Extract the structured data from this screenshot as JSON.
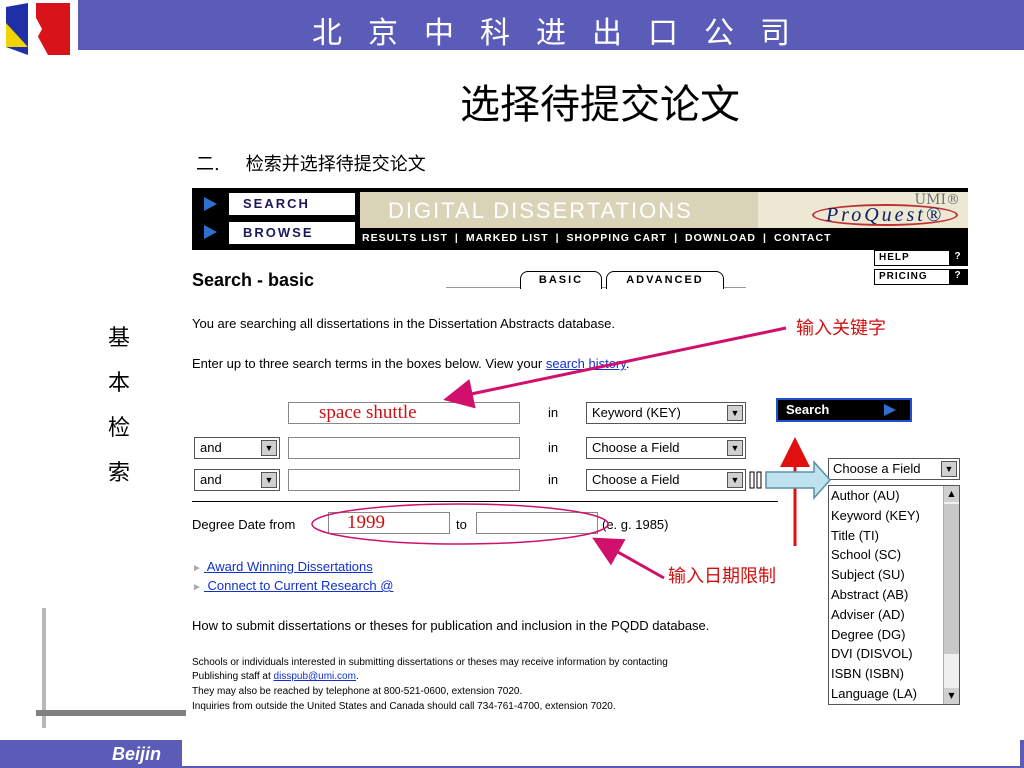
{
  "banner": {
    "title": "北京中科进出口公司"
  },
  "slide": {
    "title": "选择待提交论文",
    "subtitle_num": "二.",
    "subtitle_text": "检索并选择待提交论文"
  },
  "side_label": [
    "基",
    "本",
    "检",
    "索"
  ],
  "proquest": {
    "nav_search": "SEARCH",
    "nav_browse": "BROWSE",
    "banner_title": "DIGITAL DISSERTATIONS",
    "umi": "UMI®",
    "logo": "ProQuest®",
    "topnav": [
      "RESULTS LIST",
      "MARKED LIST",
      "SHOPPING CART",
      "DOWNLOAD",
      "CONTACT"
    ],
    "help": "HELP",
    "pricing": "PRICING",
    "q": "?",
    "page_heading": "Search - basic",
    "tab_basic": "BASIC",
    "tab_advanced": "ADVANCED",
    "info_line1": "You are searching all dissertations in the Dissertation Abstracts database.",
    "info_line2_prefix": "Enter up to three search terms in the boxes below. View your ",
    "info_line2_link": "search history",
    "info_line2_suffix": ".",
    "term1_value": "space shuttle",
    "in_label": "in",
    "field1": "Keyword (KEY)",
    "field2": "Choose a Field",
    "field3": "Choose a Field",
    "op2": "and",
    "op3": "and",
    "search_button": "Search",
    "degree_label": "Degree Date  from",
    "degree_from": "1999",
    "degree_to_label": "to",
    "degree_example": "(e. g. 1985)",
    "link_award": " Award Winning Dissertations",
    "link_connect": " Connect to Current Research @",
    "para_submit": "How to submit dissertations or theses for publication and inclusion in the PQDD database.",
    "small1": "Schools or individuals interested in submitting dissertations or theses may receive information by contacting",
    "small2_prefix": "Publishing staff at ",
    "small2_link": "disspub@umi.com",
    "small2_suffix": ".",
    "small3": "They may also be reached by telephone at 800-521-0600, extension 7020.",
    "small4": "Inquiries from outside the United States and Canada should call 734-761-4700, extension 7020."
  },
  "dropdown": {
    "header": "Choose a Field",
    "items": [
      "Author (AU)",
      "Keyword (KEY)",
      "Title (TI)",
      "School (SC)",
      "Subject (SU)",
      "Abstract (AB)",
      "Adviser (AD)",
      "Degree (DG)",
      "DVI (DISVOL)",
      "ISBN (ISBN)",
      "Language (LA)"
    ]
  },
  "annotations": {
    "keyword": "输入关键字",
    "date": "输入日期限制"
  },
  "footer": {
    "text": "Beijin"
  },
  "colors": {
    "banner": "#5a5cb8",
    "annotation": "#d01010",
    "arrow": "#d0106a",
    "link": "#1030d0"
  }
}
